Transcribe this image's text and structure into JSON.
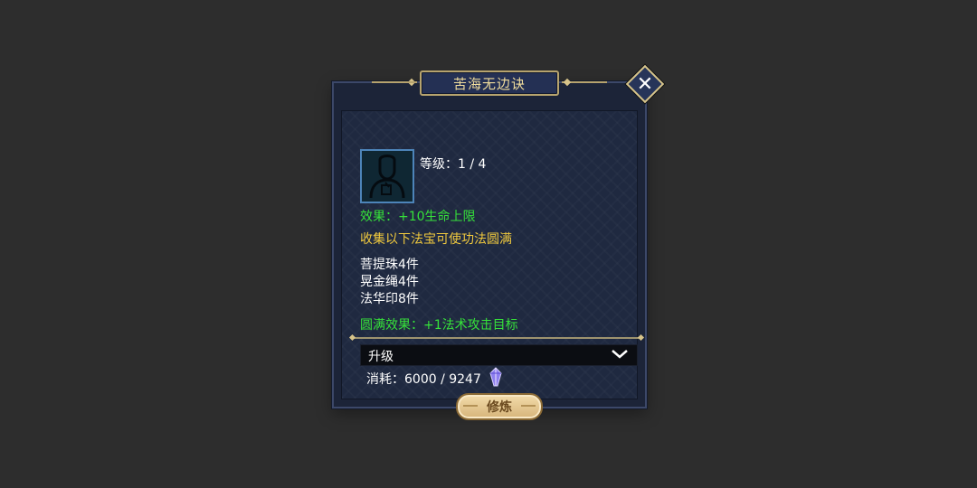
{
  "dialog": {
    "title": "苦海无边诀",
    "close_icon": "close-icon"
  },
  "item": {
    "icon": "silhouette-icon",
    "level_text": "等级：1 / 4",
    "effect_text": "效果：+10生命上限",
    "collect_text": "收集以下法宝可使功法圆满",
    "requirements": [
      "菩提珠4件",
      "晃金绳4件",
      "法华印8件"
    ],
    "complete_effect_text": "圆满效果：+1法术攻击目标"
  },
  "upgrade": {
    "select_label": "升级",
    "chevron_icon": "chevron-down-icon",
    "cost_text": "消耗：6000 / 9247",
    "gem_icon": "gem-icon",
    "train_button_label": "修炼"
  },
  "colors": {
    "effect_green": "#36e23a",
    "collect_yellow": "#f0c93e",
    "title_gold": "#f0dc9c"
  }
}
